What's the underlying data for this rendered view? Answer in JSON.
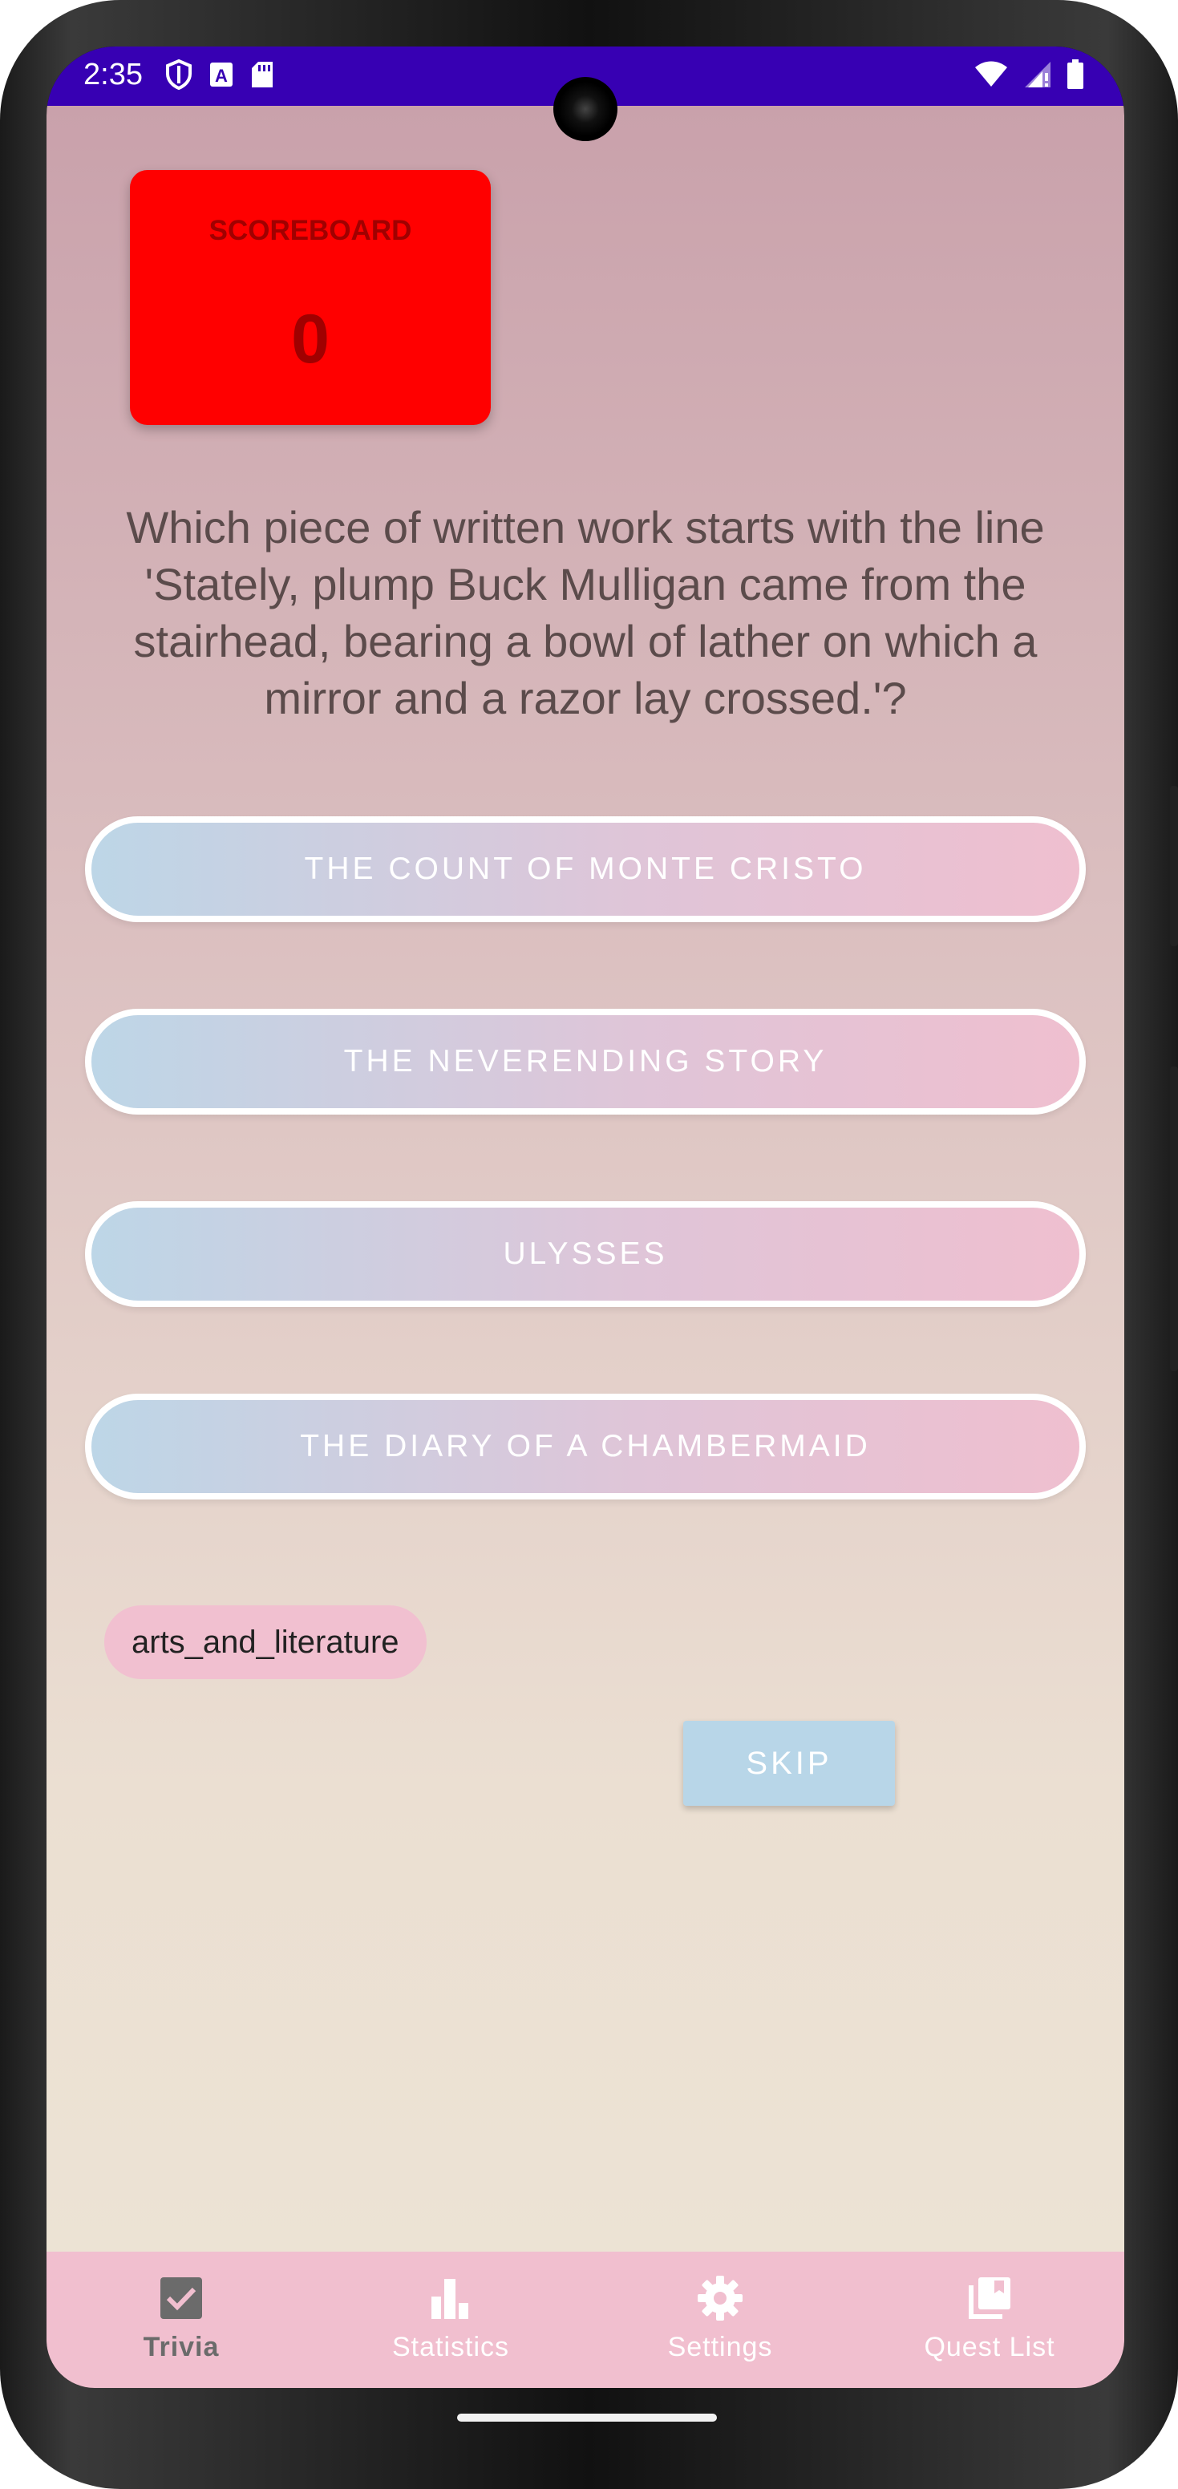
{
  "status_bar": {
    "time": "2:35",
    "left_icons": [
      "shield-icon",
      "font-icon",
      "sd-card-icon"
    ],
    "right_icons": [
      "wifi-icon",
      "signal-icon",
      "battery-icon"
    ],
    "bg_color": "#3700b3"
  },
  "scoreboard": {
    "title": "SCOREBOARD",
    "score": "0",
    "bg_color": "#ff0000"
  },
  "question": {
    "text": "Which piece of written work starts with the line 'Stately, plump Buck Mulligan came from the stairhead, bearing a bowl of lather on which a mirror and a razor lay crossed.'?"
  },
  "answers": [
    {
      "label": "THE COUNT OF MONTE CRISTO"
    },
    {
      "label": "THE NEVERENDING STORY"
    },
    {
      "label": "ULYSSES"
    },
    {
      "label": "THE DIARY OF A CHAMBERMAID"
    }
  ],
  "category": {
    "label": "arts_and_literature"
  },
  "skip_button": {
    "label": "SKIP"
  },
  "bottom_nav": {
    "items": [
      {
        "label": "Trivia",
        "icon": "checkbox-icon",
        "active": true
      },
      {
        "label": "Statistics",
        "icon": "bar-chart-icon",
        "active": false
      },
      {
        "label": "Settings",
        "icon": "gear-icon",
        "active": false
      },
      {
        "label": "Quest List",
        "icon": "library-icon",
        "active": false
      }
    ],
    "bg_color": "#f1bfcf"
  }
}
